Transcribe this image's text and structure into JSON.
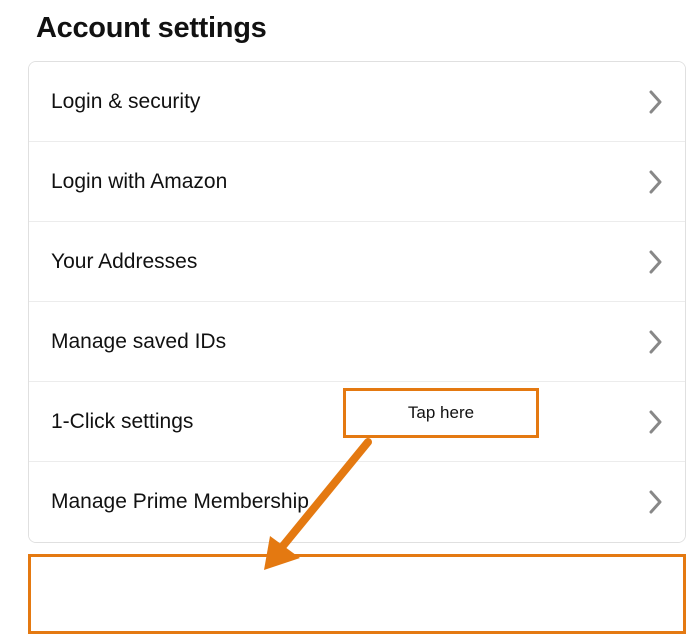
{
  "page": {
    "title": "Account settings"
  },
  "settings": {
    "items": [
      {
        "label": "Login & security"
      },
      {
        "label": "Login with Amazon"
      },
      {
        "label": "Your Addresses"
      },
      {
        "label": "Manage saved IDs"
      },
      {
        "label": "1-Click settings"
      },
      {
        "label": "Manage Prime Membership"
      }
    ]
  },
  "annotation": {
    "callout_text": "Tap here",
    "colors": {
      "highlight": "#e47911"
    }
  }
}
